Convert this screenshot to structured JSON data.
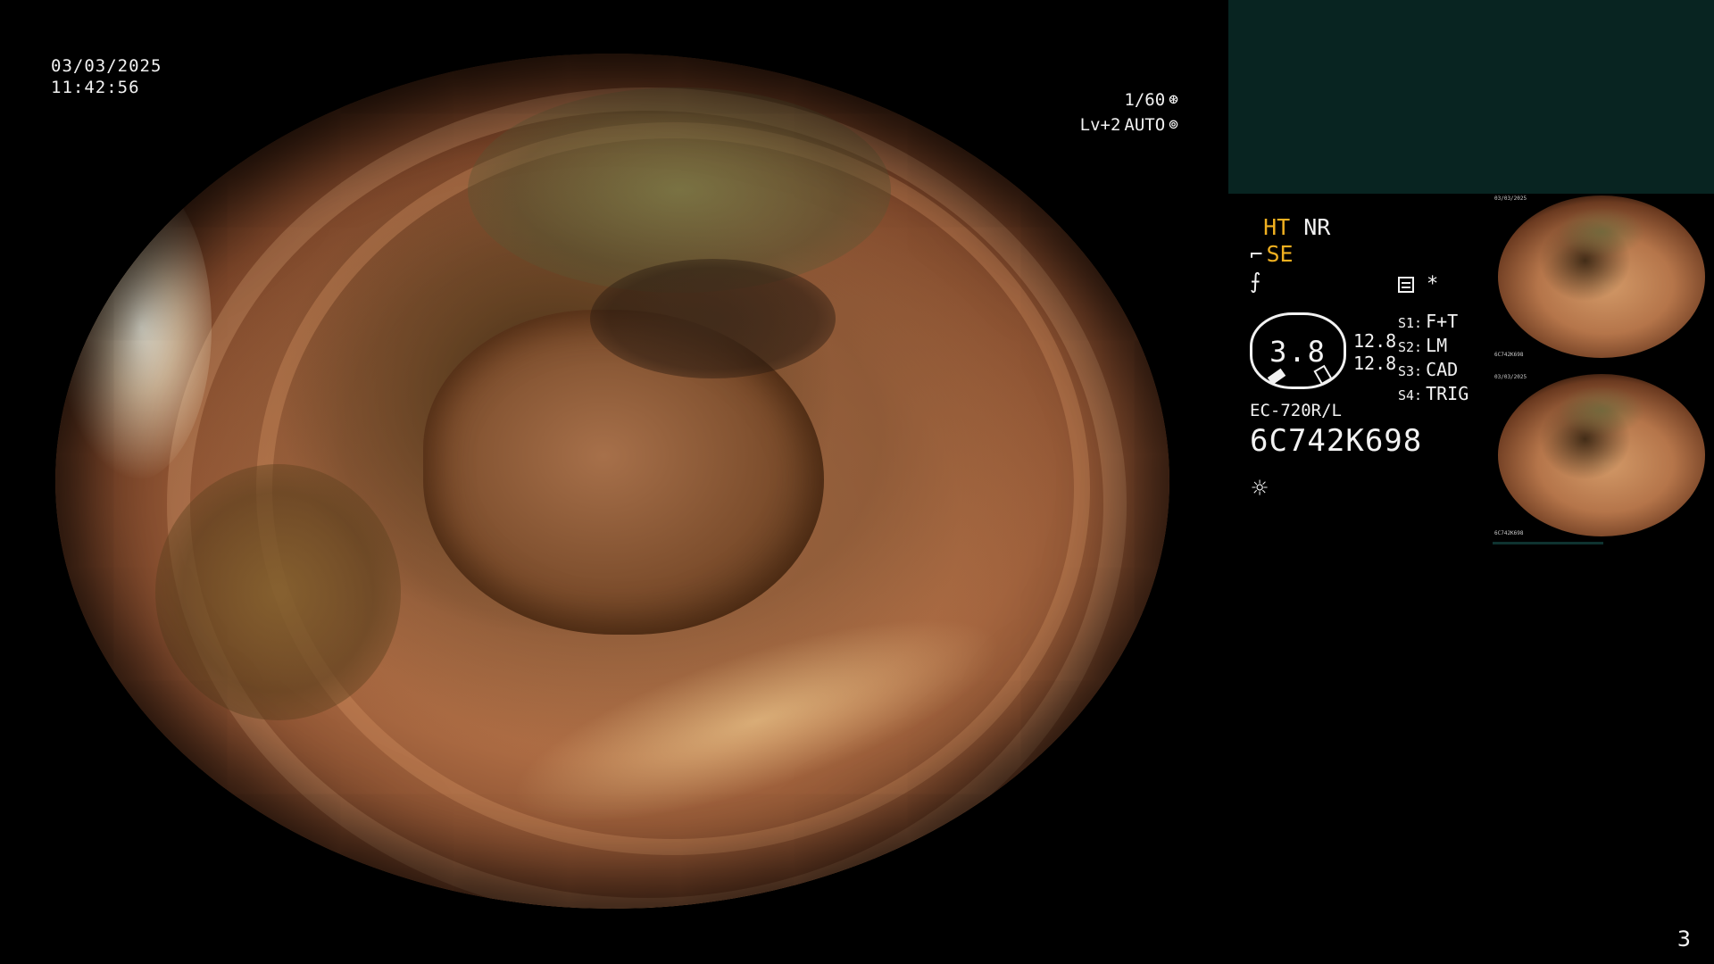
{
  "overlay": {
    "date": "03/03/2025",
    "time": "11:42:56",
    "shutter": "1/60",
    "shutter_icon": "aperture-icon",
    "exposure_level": "Lv+2",
    "exposure_mode": "AUTO",
    "exposure_icon": "iris-icon"
  },
  "modes": {
    "ht": "HT",
    "nr": "NR",
    "se": "SE",
    "se_icon": "structure-enhance-icon",
    "freeze_icon": "freeze-icon"
  },
  "dial": {
    "value": "3.8",
    "readout_1": "12.8",
    "readout_2": "12.8"
  },
  "switches": [
    {
      "key": "S1:",
      "value": "F+T"
    },
    {
      "key": "S2:",
      "value": "LM"
    },
    {
      "key": "S3:",
      "value": "CAD"
    },
    {
      "key": "S4:",
      "value": "TRIG"
    }
  ],
  "switch_icons": {
    "memo": "memo-icon",
    "asterisk": "*"
  },
  "scope": {
    "model": "EC-720R/L",
    "serial": "6C742K698",
    "light_icon": "light-source-icon"
  },
  "thumbnails": {
    "t1_date": "03/03/2025",
    "t1_serial": "6C742K698",
    "t2_date": "03/03/2025",
    "t2_serial": "6C742K698"
  },
  "page": {
    "number": "3"
  },
  "colors": {
    "amber": "#f0b020",
    "teal_panel": "#082421",
    "text": "#f2f2f2"
  }
}
